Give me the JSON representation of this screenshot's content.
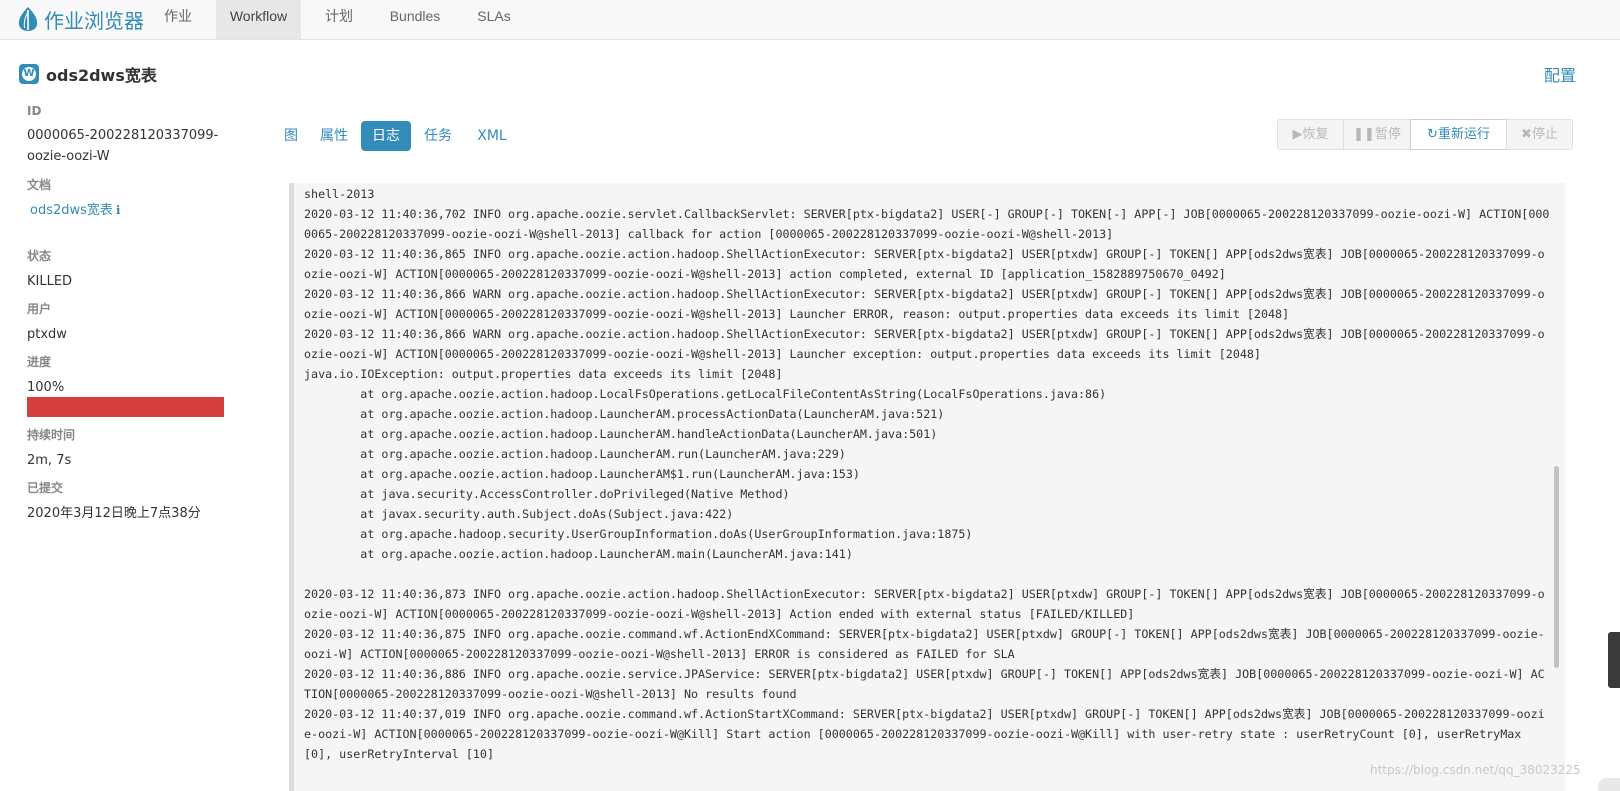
{
  "app": {
    "title": "作业浏览器",
    "colors": {
      "accent": "#338bb8",
      "progress": "#d53f3f",
      "log_bg": "#f5f5f5"
    }
  },
  "nav": {
    "items": [
      {
        "label": "作业",
        "active": false
      },
      {
        "label": "Workflow",
        "active": true
      },
      {
        "label": "计划",
        "active": false
      },
      {
        "label": "Bundles",
        "active": false
      },
      {
        "label": "SLAs",
        "active": false
      }
    ]
  },
  "header": {
    "badge_letter": "W",
    "job_name": "ods2dws宽表",
    "config_label": "配置"
  },
  "sidebar": {
    "id_label": "ID",
    "id_value": "0000065-200228120337099-oozie-oozi-W",
    "doc_label": "文档",
    "doc_value": "ods2dws宽表",
    "doc_icon": "info-icon",
    "status_label": "状态",
    "status_value": "KILLED",
    "user_label": "用户",
    "user_value": "ptxdw",
    "progress_label": "进度",
    "progress_value": "100%",
    "progress_fraction": 1.0,
    "duration_label": "持续时间",
    "duration_value": "2m, 7s",
    "submitted_label": "已提交",
    "submitted_value": "2020年3月12日晚上7点38分"
  },
  "tabs": [
    {
      "label": "图",
      "active": false
    },
    {
      "label": "属性",
      "active": false
    },
    {
      "label": "日志",
      "active": true
    },
    {
      "label": "任务",
      "active": false
    },
    {
      "label": "XML",
      "active": false
    }
  ],
  "actions": {
    "resume": {
      "icon": "play-icon",
      "label": "恢复",
      "enabled": false
    },
    "suspend": {
      "icon": "pause-icon",
      "label": "暂停",
      "enabled": false
    },
    "rerun": {
      "icon": "refresh-icon",
      "label": "重新运行",
      "enabled": true
    },
    "kill": {
      "icon": "close-icon",
      "label": "停止",
      "enabled": false
    }
  },
  "log": {
    "lines": [
      "shell-2013",
      "2020-03-12 11:40:36,702 INFO org.apache.oozie.servlet.CallbackServlet: SERVER[ptx-bigdata2] USER[-] GROUP[-] TOKEN[-] APP[-] JOB[0000065-200228120337099-oozie-oozi-W] ACTION[0000065-200228120337099-oozie-oozi-W@shell-2013] callback for action [0000065-200228120337099-oozie-oozi-W@shell-2013]",
      "2020-03-12 11:40:36,865 INFO org.apache.oozie.action.hadoop.ShellActionExecutor: SERVER[ptx-bigdata2] USER[ptxdw] GROUP[-] TOKEN[] APP[ods2dws宽表] JOB[0000065-200228120337099-oozie-oozi-W] ACTION[0000065-200228120337099-oozie-oozi-W@shell-2013] action completed, external ID [application_1582889750670_0492]",
      "2020-03-12 11:40:36,866 WARN org.apache.oozie.action.hadoop.ShellActionExecutor: SERVER[ptx-bigdata2] USER[ptxdw] GROUP[-] TOKEN[] APP[ods2dws宽表] JOB[0000065-200228120337099-oozie-oozi-W] ACTION[0000065-200228120337099-oozie-oozi-W@shell-2013] Launcher ERROR, reason: output.properties data exceeds its limit [2048]",
      "2020-03-12 11:40:36,866 WARN org.apache.oozie.action.hadoop.ShellActionExecutor: SERVER[ptx-bigdata2] USER[ptxdw] GROUP[-] TOKEN[] APP[ods2dws宽表] JOB[0000065-200228120337099-oozie-oozi-W] ACTION[0000065-200228120337099-oozie-oozi-W@shell-2013] Launcher exception: output.properties data exceeds its limit [2048]",
      "java.io.IOException: output.properties data exceeds its limit [2048]",
      "\tat org.apache.oozie.action.hadoop.LocalFsOperations.getLocalFileContentAsString(LocalFsOperations.java:86)",
      "\tat org.apache.oozie.action.hadoop.LauncherAM.processActionData(LauncherAM.java:521)",
      "\tat org.apache.oozie.action.hadoop.LauncherAM.handleActionData(LauncherAM.java:501)",
      "\tat org.apache.oozie.action.hadoop.LauncherAM.run(LauncherAM.java:229)",
      "\tat org.apache.oozie.action.hadoop.LauncherAM$1.run(LauncherAM.java:153)",
      "\tat java.security.AccessController.doPrivileged(Native Method)",
      "\tat javax.security.auth.Subject.doAs(Subject.java:422)",
      "\tat org.apache.hadoop.security.UserGroupInformation.doAs(UserGroupInformation.java:1875)",
      "\tat org.apache.oozie.action.hadoop.LauncherAM.main(LauncherAM.java:141)",
      "",
      "2020-03-12 11:40:36,873 INFO org.apache.oozie.action.hadoop.ShellActionExecutor: SERVER[ptx-bigdata2] USER[ptxdw] GROUP[-] TOKEN[] APP[ods2dws宽表] JOB[0000065-200228120337099-oozie-oozi-W] ACTION[0000065-200228120337099-oozie-oozi-W@shell-2013] Action ended with external status [FAILED/KILLED]",
      "2020-03-12 11:40:36,875 INFO org.apache.oozie.command.wf.ActionEndXCommand: SERVER[ptx-bigdata2] USER[ptxdw] GROUP[-] TOKEN[] APP[ods2dws宽表] JOB[0000065-200228120337099-oozie-oozi-W] ACTION[0000065-200228120337099-oozie-oozi-W@shell-2013] ERROR is considered as FAILED for SLA",
      "2020-03-12 11:40:36,886 INFO org.apache.oozie.service.JPAService: SERVER[ptx-bigdata2] USER[ptxdw] GROUP[-] TOKEN[] APP[ods2dws宽表] JOB[0000065-200228120337099-oozie-oozi-W] ACTION[0000065-200228120337099-oozie-oozi-W@shell-2013] No results found",
      "2020-03-12 11:40:37,019 INFO org.apache.oozie.command.wf.ActionStartXCommand: SERVER[ptx-bigdata2] USER[ptxdw] GROUP[-] TOKEN[] APP[ods2dws宽表] JOB[0000065-200228120337099-oozie-oozi-W] ACTION[0000065-200228120337099-oozie-oozi-W@Kill] Start action [0000065-200228120337099-oozie-oozi-W@Kill] with user-retry state : userRetryCount [0], userRetryMax [0], userRetryInterval [10]"
    ]
  },
  "watermark": "https://blog.csdn.net/qq_38023225"
}
